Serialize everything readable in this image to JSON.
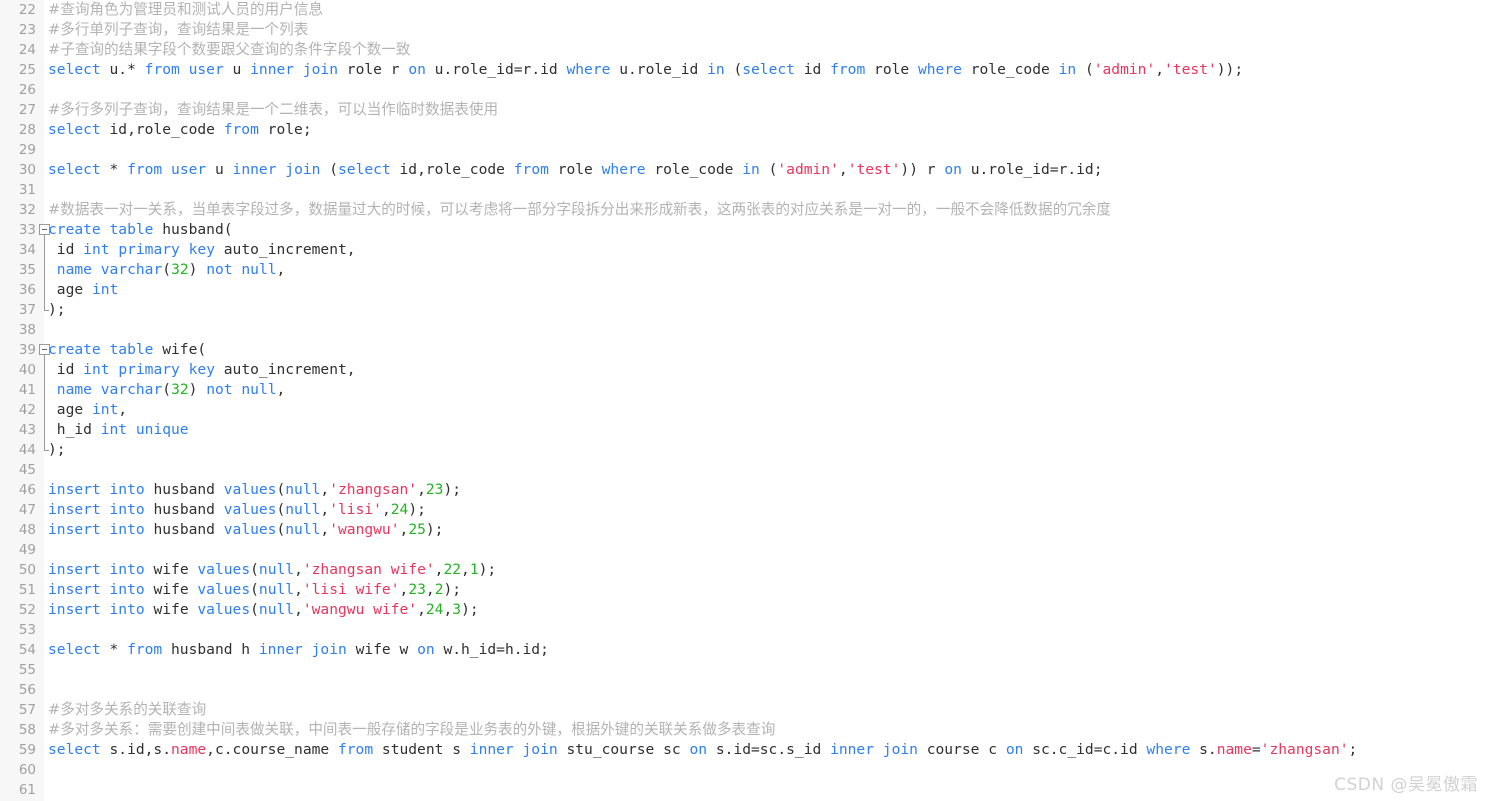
{
  "editor": {
    "first_line_number": 22,
    "theme_colors": {
      "background": "#ffffff",
      "gutter_background": "#f7f7f7",
      "line_number": "#a0a0a0",
      "keyword": "#2f7ff0",
      "string": "#e8365f",
      "number": "#24b324",
      "comment": "#b3b3b3",
      "text": "#303030",
      "fold_marker": "#9a9a9a"
    },
    "language": "SQL"
  },
  "watermark": {
    "text": "CSDN @吴冕傲霜"
  },
  "lines": [
    {
      "n": 22,
      "fold": "none",
      "tokens": [
        {
          "t": "#查询角色为管理员和测试人员的用户信息",
          "c": "cmt zh"
        }
      ]
    },
    {
      "n": 23,
      "fold": "none",
      "tokens": [
        {
          "t": "#多行单列子查询，查询结果是一个列表",
          "c": "cmt zh"
        }
      ]
    },
    {
      "n": 24,
      "fold": "none",
      "tokens": [
        {
          "t": "#子查询的结果字段个数要跟父查询的条件字段个数一致",
          "c": "cmt zh"
        }
      ]
    },
    {
      "n": 25,
      "fold": "none",
      "tokens": [
        {
          "t": "select",
          "c": "kw"
        },
        {
          "t": " u.* ",
          "c": "plain"
        },
        {
          "t": "from",
          "c": "kw"
        },
        {
          "t": " ",
          "c": "plain"
        },
        {
          "t": "user",
          "c": "kw"
        },
        {
          "t": " u ",
          "c": "plain"
        },
        {
          "t": "inner",
          "c": "kw"
        },
        {
          "t": " ",
          "c": "plain"
        },
        {
          "t": "join",
          "c": "kw"
        },
        {
          "t": " role r ",
          "c": "plain"
        },
        {
          "t": "on",
          "c": "kw"
        },
        {
          "t": " u.role_id=r.id ",
          "c": "plain"
        },
        {
          "t": "where",
          "c": "kw"
        },
        {
          "t": " u.role_id ",
          "c": "plain"
        },
        {
          "t": "in",
          "c": "kw"
        },
        {
          "t": " (",
          "c": "plain"
        },
        {
          "t": "select",
          "c": "kw"
        },
        {
          "t": " id ",
          "c": "plain"
        },
        {
          "t": "from",
          "c": "kw"
        },
        {
          "t": " role ",
          "c": "plain"
        },
        {
          "t": "where",
          "c": "kw"
        },
        {
          "t": " role_code ",
          "c": "plain"
        },
        {
          "t": "in",
          "c": "kw"
        },
        {
          "t": " (",
          "c": "plain"
        },
        {
          "t": "'admin'",
          "c": "str"
        },
        {
          "t": ",",
          "c": "plain"
        },
        {
          "t": "'test'",
          "c": "str"
        },
        {
          "t": "));",
          "c": "plain"
        }
      ]
    },
    {
      "n": 26,
      "fold": "none",
      "tokens": []
    },
    {
      "n": 27,
      "fold": "none",
      "tokens": [
        {
          "t": "#多行多列子查询，查询结果是一个二维表，可以当作临时数据表使用",
          "c": "cmt zh"
        }
      ]
    },
    {
      "n": 28,
      "fold": "none",
      "tokens": [
        {
          "t": "select",
          "c": "kw"
        },
        {
          "t": " id,role_code ",
          "c": "plain"
        },
        {
          "t": "from",
          "c": "kw"
        },
        {
          "t": " role;",
          "c": "plain"
        }
      ]
    },
    {
      "n": 29,
      "fold": "none",
      "tokens": []
    },
    {
      "n": 30,
      "fold": "none",
      "tokens": [
        {
          "t": "select",
          "c": "kw"
        },
        {
          "t": " * ",
          "c": "plain"
        },
        {
          "t": "from",
          "c": "kw"
        },
        {
          "t": " ",
          "c": "plain"
        },
        {
          "t": "user",
          "c": "kw"
        },
        {
          "t": " u ",
          "c": "plain"
        },
        {
          "t": "inner",
          "c": "kw"
        },
        {
          "t": " ",
          "c": "plain"
        },
        {
          "t": "join",
          "c": "kw"
        },
        {
          "t": " (",
          "c": "plain"
        },
        {
          "t": "select",
          "c": "kw"
        },
        {
          "t": " id,role_code ",
          "c": "plain"
        },
        {
          "t": "from",
          "c": "kw"
        },
        {
          "t": " role ",
          "c": "plain"
        },
        {
          "t": "where",
          "c": "kw"
        },
        {
          "t": " role_code ",
          "c": "plain"
        },
        {
          "t": "in",
          "c": "kw"
        },
        {
          "t": " (",
          "c": "plain"
        },
        {
          "t": "'admin'",
          "c": "str"
        },
        {
          "t": ",",
          "c": "plain"
        },
        {
          "t": "'test'",
          "c": "str"
        },
        {
          "t": ")) r ",
          "c": "plain"
        },
        {
          "t": "on",
          "c": "kw"
        },
        {
          "t": " u.role_id=r.id;",
          "c": "plain"
        }
      ]
    },
    {
      "n": 31,
      "fold": "none",
      "tokens": []
    },
    {
      "n": 32,
      "fold": "none",
      "tokens": [
        {
          "t": "#数据表一对一关系，当单表字段过多，数据量过大的时候，可以考虑将一部分字段拆分出来形成新表，这两张表的对应关系是一对一的，一般不会降低数据的冗余度",
          "c": "cmt zh"
        }
      ]
    },
    {
      "n": 33,
      "fold": "start",
      "tokens": [
        {
          "t": "create",
          "c": "kw"
        },
        {
          "t": " ",
          "c": "plain"
        },
        {
          "t": "table",
          "c": "kw"
        },
        {
          "t": " husband(",
          "c": "plain"
        }
      ]
    },
    {
      "n": 34,
      "fold": "mid",
      "tokens": [
        {
          "t": " id ",
          "c": "plain"
        },
        {
          "t": "int",
          "c": "kw"
        },
        {
          "t": " ",
          "c": "plain"
        },
        {
          "t": "primary",
          "c": "kw"
        },
        {
          "t": " ",
          "c": "plain"
        },
        {
          "t": "key",
          "c": "kw"
        },
        {
          "t": " auto_increment,",
          "c": "plain"
        }
      ]
    },
    {
      "n": 35,
      "fold": "mid",
      "tokens": [
        {
          "t": " ",
          "c": "plain"
        },
        {
          "t": "name",
          "c": "kw"
        },
        {
          "t": " ",
          "c": "plain"
        },
        {
          "t": "varchar",
          "c": "kw"
        },
        {
          "t": "(",
          "c": "plain"
        },
        {
          "t": "32",
          "c": "num"
        },
        {
          "t": ") ",
          "c": "plain"
        },
        {
          "t": "not",
          "c": "kw"
        },
        {
          "t": " ",
          "c": "plain"
        },
        {
          "t": "null",
          "c": "kw"
        },
        {
          "t": ",",
          "c": "plain"
        }
      ]
    },
    {
      "n": 36,
      "fold": "mid",
      "tokens": [
        {
          "t": " age ",
          "c": "plain"
        },
        {
          "t": "int",
          "c": "kw"
        }
      ]
    },
    {
      "n": 37,
      "fold": "end",
      "tokens": [
        {
          "t": ");",
          "c": "plain"
        }
      ]
    },
    {
      "n": 38,
      "fold": "none",
      "tokens": []
    },
    {
      "n": 39,
      "fold": "start",
      "tokens": [
        {
          "t": "create",
          "c": "kw"
        },
        {
          "t": " ",
          "c": "plain"
        },
        {
          "t": "table",
          "c": "kw"
        },
        {
          "t": " wife(",
          "c": "plain"
        }
      ]
    },
    {
      "n": 40,
      "fold": "mid",
      "tokens": [
        {
          "t": " id ",
          "c": "plain"
        },
        {
          "t": "int",
          "c": "kw"
        },
        {
          "t": " ",
          "c": "plain"
        },
        {
          "t": "primary",
          "c": "kw"
        },
        {
          "t": " ",
          "c": "plain"
        },
        {
          "t": "key",
          "c": "kw"
        },
        {
          "t": " auto_increment,",
          "c": "plain"
        }
      ]
    },
    {
      "n": 41,
      "fold": "mid",
      "tokens": [
        {
          "t": " ",
          "c": "plain"
        },
        {
          "t": "name",
          "c": "kw"
        },
        {
          "t": " ",
          "c": "plain"
        },
        {
          "t": "varchar",
          "c": "kw"
        },
        {
          "t": "(",
          "c": "plain"
        },
        {
          "t": "32",
          "c": "num"
        },
        {
          "t": ") ",
          "c": "plain"
        },
        {
          "t": "not",
          "c": "kw"
        },
        {
          "t": " ",
          "c": "plain"
        },
        {
          "t": "null",
          "c": "kw"
        },
        {
          "t": ",",
          "c": "plain"
        }
      ]
    },
    {
      "n": 42,
      "fold": "mid",
      "tokens": [
        {
          "t": " age ",
          "c": "plain"
        },
        {
          "t": "int",
          "c": "kw"
        },
        {
          "t": ",",
          "c": "plain"
        }
      ]
    },
    {
      "n": 43,
      "fold": "mid",
      "tokens": [
        {
          "t": " h_id ",
          "c": "plain"
        },
        {
          "t": "int",
          "c": "kw"
        },
        {
          "t": " ",
          "c": "plain"
        },
        {
          "t": "unique",
          "c": "kw"
        }
      ]
    },
    {
      "n": 44,
      "fold": "end",
      "tokens": [
        {
          "t": ");",
          "c": "plain"
        }
      ]
    },
    {
      "n": 45,
      "fold": "none",
      "tokens": []
    },
    {
      "n": 46,
      "fold": "none",
      "tokens": [
        {
          "t": "insert",
          "c": "kw"
        },
        {
          "t": " ",
          "c": "plain"
        },
        {
          "t": "into",
          "c": "kw"
        },
        {
          "t": " husband ",
          "c": "plain"
        },
        {
          "t": "values",
          "c": "kw"
        },
        {
          "t": "(",
          "c": "plain"
        },
        {
          "t": "null",
          "c": "kw"
        },
        {
          "t": ",",
          "c": "plain"
        },
        {
          "t": "'zhangsan'",
          "c": "str"
        },
        {
          "t": ",",
          "c": "plain"
        },
        {
          "t": "23",
          "c": "num"
        },
        {
          "t": ");",
          "c": "plain"
        }
      ]
    },
    {
      "n": 47,
      "fold": "none",
      "tokens": [
        {
          "t": "insert",
          "c": "kw"
        },
        {
          "t": " ",
          "c": "plain"
        },
        {
          "t": "into",
          "c": "kw"
        },
        {
          "t": " husband ",
          "c": "plain"
        },
        {
          "t": "values",
          "c": "kw"
        },
        {
          "t": "(",
          "c": "plain"
        },
        {
          "t": "null",
          "c": "kw"
        },
        {
          "t": ",",
          "c": "plain"
        },
        {
          "t": "'lisi'",
          "c": "str"
        },
        {
          "t": ",",
          "c": "plain"
        },
        {
          "t": "24",
          "c": "num"
        },
        {
          "t": ");",
          "c": "plain"
        }
      ]
    },
    {
      "n": 48,
      "fold": "none",
      "tokens": [
        {
          "t": "insert",
          "c": "kw"
        },
        {
          "t": " ",
          "c": "plain"
        },
        {
          "t": "into",
          "c": "kw"
        },
        {
          "t": " husband ",
          "c": "plain"
        },
        {
          "t": "values",
          "c": "kw"
        },
        {
          "t": "(",
          "c": "plain"
        },
        {
          "t": "null",
          "c": "kw"
        },
        {
          "t": ",",
          "c": "plain"
        },
        {
          "t": "'wangwu'",
          "c": "str"
        },
        {
          "t": ",",
          "c": "plain"
        },
        {
          "t": "25",
          "c": "num"
        },
        {
          "t": ");",
          "c": "plain"
        }
      ]
    },
    {
      "n": 49,
      "fold": "none",
      "tokens": []
    },
    {
      "n": 50,
      "fold": "none",
      "tokens": [
        {
          "t": "insert",
          "c": "kw"
        },
        {
          "t": " ",
          "c": "plain"
        },
        {
          "t": "into",
          "c": "kw"
        },
        {
          "t": " wife ",
          "c": "plain"
        },
        {
          "t": "values",
          "c": "kw"
        },
        {
          "t": "(",
          "c": "plain"
        },
        {
          "t": "null",
          "c": "kw"
        },
        {
          "t": ",",
          "c": "plain"
        },
        {
          "t": "'zhangsan wife'",
          "c": "str"
        },
        {
          "t": ",",
          "c": "plain"
        },
        {
          "t": "22",
          "c": "num"
        },
        {
          "t": ",",
          "c": "plain"
        },
        {
          "t": "1",
          "c": "num"
        },
        {
          "t": ");",
          "c": "plain"
        }
      ]
    },
    {
      "n": 51,
      "fold": "none",
      "tokens": [
        {
          "t": "insert",
          "c": "kw"
        },
        {
          "t": " ",
          "c": "plain"
        },
        {
          "t": "into",
          "c": "kw"
        },
        {
          "t": " wife ",
          "c": "plain"
        },
        {
          "t": "values",
          "c": "kw"
        },
        {
          "t": "(",
          "c": "plain"
        },
        {
          "t": "null",
          "c": "kw"
        },
        {
          "t": ",",
          "c": "plain"
        },
        {
          "t": "'lisi wife'",
          "c": "str"
        },
        {
          "t": ",",
          "c": "plain"
        },
        {
          "t": "23",
          "c": "num"
        },
        {
          "t": ",",
          "c": "plain"
        },
        {
          "t": "2",
          "c": "num"
        },
        {
          "t": ");",
          "c": "plain"
        }
      ]
    },
    {
      "n": 52,
      "fold": "none",
      "tokens": [
        {
          "t": "insert",
          "c": "kw"
        },
        {
          "t": " ",
          "c": "plain"
        },
        {
          "t": "into",
          "c": "kw"
        },
        {
          "t": " wife ",
          "c": "plain"
        },
        {
          "t": "values",
          "c": "kw"
        },
        {
          "t": "(",
          "c": "plain"
        },
        {
          "t": "null",
          "c": "kw"
        },
        {
          "t": ",",
          "c": "plain"
        },
        {
          "t": "'wangwu wife'",
          "c": "str"
        },
        {
          "t": ",",
          "c": "plain"
        },
        {
          "t": "24",
          "c": "num"
        },
        {
          "t": ",",
          "c": "plain"
        },
        {
          "t": "3",
          "c": "num"
        },
        {
          "t": ");",
          "c": "plain"
        }
      ]
    },
    {
      "n": 53,
      "fold": "none",
      "tokens": []
    },
    {
      "n": 54,
      "fold": "none",
      "tokens": [
        {
          "t": "select",
          "c": "kw"
        },
        {
          "t": " * ",
          "c": "plain"
        },
        {
          "t": "from",
          "c": "kw"
        },
        {
          "t": " husband h ",
          "c": "plain"
        },
        {
          "t": "inner",
          "c": "kw"
        },
        {
          "t": " ",
          "c": "plain"
        },
        {
          "t": "join",
          "c": "kw"
        },
        {
          "t": " wife w ",
          "c": "plain"
        },
        {
          "t": "on",
          "c": "kw"
        },
        {
          "t": " w.h_id=h.id;",
          "c": "plain"
        }
      ]
    },
    {
      "n": 55,
      "fold": "none",
      "tokens": []
    },
    {
      "n": 56,
      "fold": "none",
      "tokens": []
    },
    {
      "n": 57,
      "fold": "none",
      "tokens": [
        {
          "t": "#多对多关系的关联查询",
          "c": "cmt zh"
        }
      ]
    },
    {
      "n": 58,
      "fold": "none",
      "tokens": [
        {
          "t": "#多对多关系：需要创建中间表做关联，中间表一般存储的字段是业务表的外键，根据外键的关联关系做多表查询",
          "c": "cmt zh"
        }
      ]
    },
    {
      "n": 59,
      "fold": "none",
      "tokens": [
        {
          "t": "select",
          "c": "kw"
        },
        {
          "t": " s.id,s.",
          "c": "plain"
        },
        {
          "t": "name",
          "c": "str"
        },
        {
          "t": ",c.course_name ",
          "c": "plain"
        },
        {
          "t": "from",
          "c": "kw"
        },
        {
          "t": " student s ",
          "c": "plain"
        },
        {
          "t": "inner",
          "c": "kw"
        },
        {
          "t": " ",
          "c": "plain"
        },
        {
          "t": "join",
          "c": "kw"
        },
        {
          "t": " stu_course sc ",
          "c": "plain"
        },
        {
          "t": "on",
          "c": "kw"
        },
        {
          "t": " s.id=sc.s_id ",
          "c": "plain"
        },
        {
          "t": "inner",
          "c": "kw"
        },
        {
          "t": " ",
          "c": "plain"
        },
        {
          "t": "join",
          "c": "kw"
        },
        {
          "t": " course c ",
          "c": "plain"
        },
        {
          "t": "on",
          "c": "kw"
        },
        {
          "t": " sc.c_id=c.id ",
          "c": "plain"
        },
        {
          "t": "where",
          "c": "kw"
        },
        {
          "t": " s.",
          "c": "plain"
        },
        {
          "t": "name",
          "c": "str"
        },
        {
          "t": "=",
          "c": "plain"
        },
        {
          "t": "'zhangsan'",
          "c": "str"
        },
        {
          "t": ";",
          "c": "plain"
        }
      ]
    },
    {
      "n": 60,
      "fold": "none",
      "tokens": []
    },
    {
      "n": 61,
      "fold": "none",
      "tokens": []
    }
  ]
}
